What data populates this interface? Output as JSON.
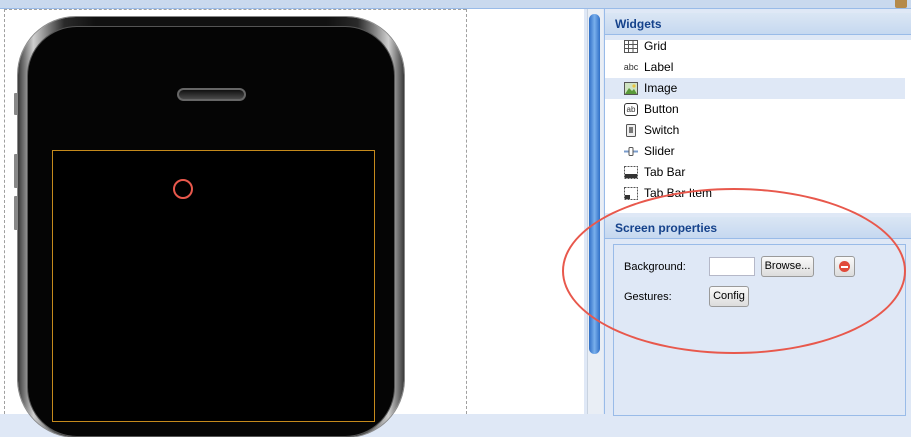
{
  "widgets_panel": {
    "title": "Widgets",
    "items": [
      {
        "label": "Grid",
        "icon": "grid-icon",
        "selected": false
      },
      {
        "label": "Label",
        "icon": "label-icon",
        "icon_text": "abc",
        "selected": false
      },
      {
        "label": "Image",
        "icon": "image-icon",
        "selected": true
      },
      {
        "label": "Button",
        "icon": "button-icon",
        "icon_text": "ab",
        "selected": false
      },
      {
        "label": "Switch",
        "icon": "switch-icon",
        "selected": false
      },
      {
        "label": "Slider",
        "icon": "slider-icon",
        "selected": false
      },
      {
        "label": "Tab Bar",
        "icon": "tab-bar-icon",
        "selected": false
      },
      {
        "label": "Tab Bar Item",
        "icon": "tab-bar-item-icon",
        "selected": false
      }
    ]
  },
  "screen_properties": {
    "title": "Screen properties",
    "background_label": "Background:",
    "background_value": "",
    "browse_label": "Browse...",
    "gestures_label": "Gestures:",
    "config_label": "Config"
  },
  "colors": {
    "accent": "#15428b",
    "annotation": "#e8584c",
    "screen_border": "#c58a1c"
  }
}
